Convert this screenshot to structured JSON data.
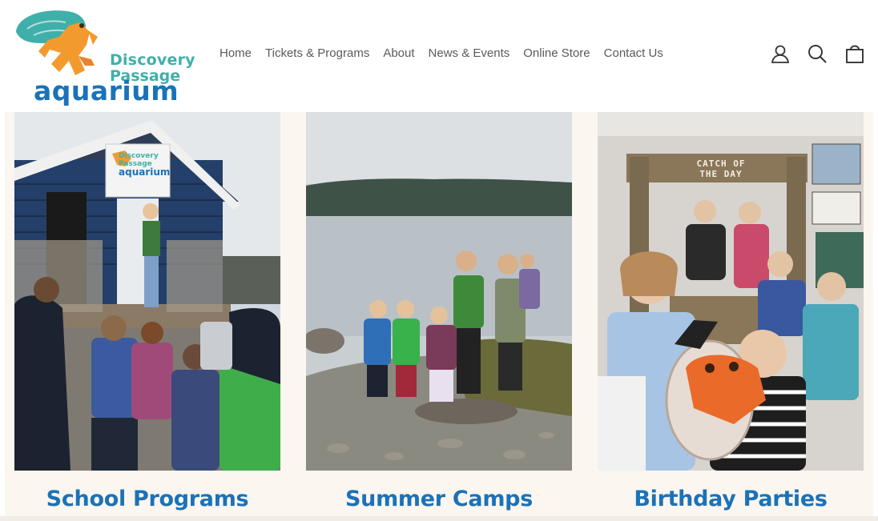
{
  "brand": {
    "line1": "Discovery",
    "line2": "Passage",
    "line3": "aquarium",
    "colors": {
      "teal": "#3fb0a9",
      "blue": "#1b72b8",
      "orange": "#f39a2e"
    }
  },
  "nav": {
    "items": [
      "Home",
      "Tickets & Programs",
      "About",
      "News & Events",
      "Online Store",
      "Contact Us"
    ]
  },
  "header_icons": [
    "account-icon",
    "search-icon",
    "cart-icon"
  ],
  "cards": [
    {
      "title": "School Programs",
      "sign": {
        "l1": "Discovery",
        "l2": "Passage",
        "l3": "aquarium"
      }
    },
    {
      "title": "Summer Camps"
    },
    {
      "title": "Birthday Parties",
      "sign": {
        "l1": "CATCH OF",
        "l2": "THE DAY"
      }
    }
  ]
}
